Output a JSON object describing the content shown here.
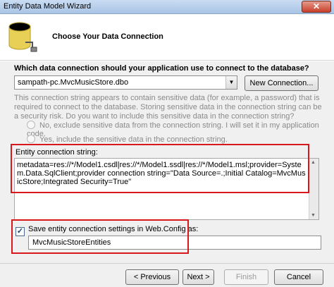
{
  "window": {
    "title": "Entity Data Model Wizard",
    "close_glyph": "✕"
  },
  "header": {
    "heading": "Choose Your Data Connection",
    "icon": "database-icon"
  },
  "connection": {
    "question": "Which data connection should your application use to connect to the database?",
    "selected": "sampath-pc.MvcMusicStore.dbo",
    "new_connection_label": "New Connection...",
    "sensitive_note": "This connection string appears to contain sensitive data (for example, a password) that is required to connect to the database. Storing sensitive data in the connection string can be a security risk. Do you want to include this sensitive data in the connection string?",
    "option_exclude": "No, exclude sensitive data from the connection string. I will set it in my application code.",
    "option_include": "Yes, include the sensitive data in the connection string."
  },
  "entity": {
    "label": "Entity connection string:",
    "value": "metadata=res://*/Model1.csdl|res://*/Model1.ssdl|res://*/Model1.msl;provider=System.Data.SqlClient;provider connection string=\"Data Source=.;Initial Catalog=MvcMusicStore;Integrated Security=True\""
  },
  "save": {
    "checked": true,
    "label": "Save entity connection settings in Web.Config as:",
    "name": "MvcMusicStoreEntities"
  },
  "buttons": {
    "previous": "< Previous",
    "next": "Next >",
    "finish": "Finish",
    "cancel": "Cancel"
  },
  "colors": {
    "highlight": "#d9181e",
    "titlebar": "#a9c4e6",
    "close": "#c8402a"
  }
}
